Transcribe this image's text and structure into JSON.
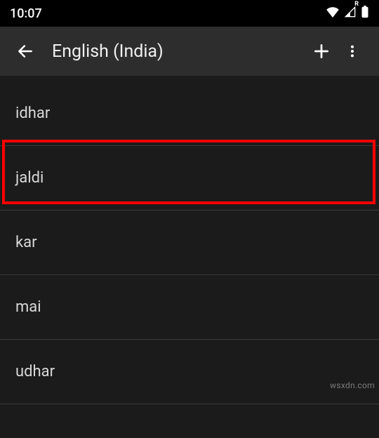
{
  "status": {
    "time": "10:07",
    "badge": "R"
  },
  "header": {
    "title": "English (India)"
  },
  "words": {
    "items": [
      {
        "label": "idhar"
      },
      {
        "label": "jaldi"
      },
      {
        "label": "kar"
      },
      {
        "label": "mai"
      },
      {
        "label": "udhar"
      }
    ]
  },
  "watermark": "wsxdn.com"
}
